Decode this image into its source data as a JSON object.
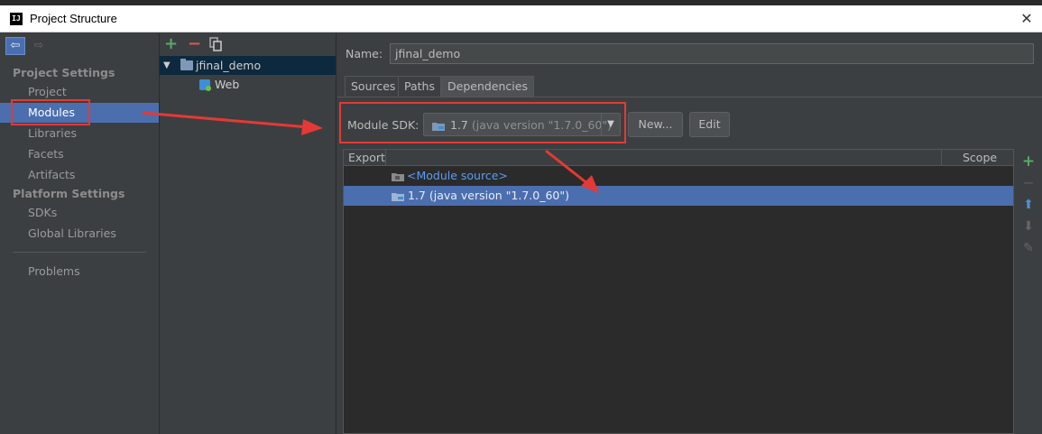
{
  "window": {
    "title": "Project Structure"
  },
  "nav": {
    "section_project": "Project Settings",
    "items_project": [
      "Project",
      "Modules",
      "Libraries",
      "Facets",
      "Artifacts"
    ],
    "section_platform": "Platform Settings",
    "items_platform": [
      "SDKs",
      "Global Libraries"
    ],
    "problems": "Problems",
    "selected": "Modules"
  },
  "tree": {
    "module": "jfinal_demo",
    "facet": "Web"
  },
  "module": {
    "name_label": "Name:",
    "name_value": "jfinal_demo",
    "tabs": [
      "Sources",
      "Paths",
      "Dependencies"
    ],
    "active_tab": "Dependencies",
    "sdk_label": "Module SDK:",
    "sdk_value": "1.7",
    "sdk_version": "(java version \"1.7.0_60\")",
    "new_button": "New...",
    "edit_button": "Edit"
  },
  "deps": {
    "col_export": "Export",
    "col_scope": "Scope",
    "rows": [
      {
        "label": "<Module source>",
        "selected": false
      },
      {
        "label": "1.7 (java version \"1.7.0_60\")",
        "selected": true
      }
    ]
  },
  "colors": {
    "accent": "#4b6eaf",
    "annotation": "#e53935",
    "add": "#59a869",
    "remove": "#e05555"
  }
}
